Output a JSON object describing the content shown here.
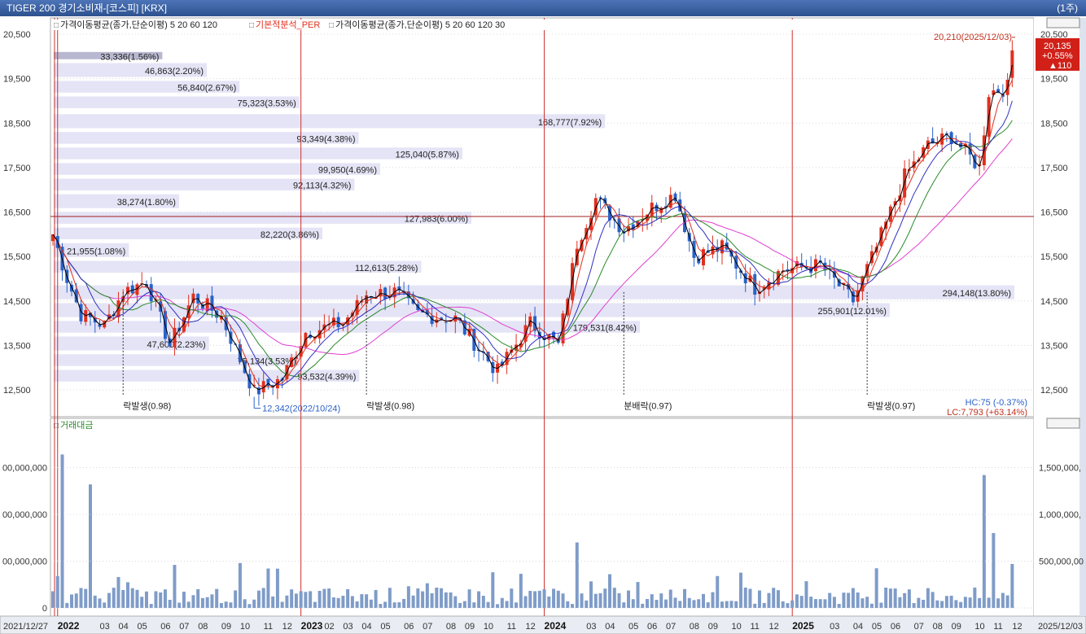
{
  "window": {
    "title": "TIGER 200 경기소비재-[코스피] [KRX]",
    "period": "(1주)"
  },
  "legends": {
    "price_ma": "가격이동평균(종가,단순이평) 5 20 60 120",
    "per": "기본적분석_PER",
    "per_ma": "가격이동평균(종가,단순이평) 5 20 60 120 30",
    "volume": "거래대금"
  },
  "colors": {
    "up": "#e0301e",
    "down": "#2a62c9",
    "ma5": "#000000",
    "ma20": "#e0301e",
    "ma60": "#2a8a2a",
    "ma120": "#e040d0",
    "ma30": "#3030c0",
    "volume_bar": "#7f9cc8",
    "profile": "#e4e4f6",
    "grid_v": "#cc3030",
    "hline": "#a02020"
  },
  "price_axis": {
    "ticks": [
      "20,500",
      "19,500",
      "18,500",
      "17,500",
      "16,500",
      "15,500",
      "14,500",
      "13,500",
      "12,500"
    ]
  },
  "right_axis": {
    "ticks": [
      "20,500",
      "19,500",
      "18,500",
      "17,500",
      "16,500",
      "15,500",
      "14,500",
      "13,500",
      "12,500"
    ]
  },
  "current_price": {
    "price": "20,135",
    "change_pct": "+0.55%",
    "change": "▲110"
  },
  "volume_axis_left": [
    "00,000,000",
    "00,000,000",
    "00,000,000",
    "0"
  ],
  "volume_axis_right": [
    "1,500,000,",
    "1,000,000,",
    "500,000,00"
  ],
  "x_axis": {
    "start_date": "2021/12/27",
    "end_date": "2025/12/03",
    "labels": [
      {
        "date": "2022-01-03",
        "text": "2022"
      },
      {
        "date": "2022-03-07",
        "text": "03"
      },
      {
        "date": "2022-04-04",
        "text": "04"
      },
      {
        "date": "2022-05-02",
        "text": "05"
      },
      {
        "date": "2022-06-06",
        "text": "06"
      },
      {
        "date": "2022-07-04",
        "text": "07"
      },
      {
        "date": "2022-08-01",
        "text": "08"
      },
      {
        "date": "2022-09-05",
        "text": "09"
      },
      {
        "date": "2022-10-03",
        "text": "10"
      },
      {
        "date": "2022-11-07",
        "text": "11"
      },
      {
        "date": "2022-12-05",
        "text": "12"
      },
      {
        "date": "2023-01-02",
        "text": "2023"
      },
      {
        "date": "2023-02-06",
        "text": "02"
      },
      {
        "date": "2023-03-06",
        "text": "03"
      },
      {
        "date": "2023-04-03",
        "text": "04"
      },
      {
        "date": "2023-05-01",
        "text": "05"
      },
      {
        "date": "2023-06-05",
        "text": "06"
      },
      {
        "date": "2023-07-03",
        "text": "07"
      },
      {
        "date": "2023-08-07",
        "text": "08"
      },
      {
        "date": "2023-09-04",
        "text": "09"
      },
      {
        "date": "2023-10-02",
        "text": "10"
      },
      {
        "date": "2023-11-06",
        "text": "11"
      },
      {
        "date": "2023-12-04",
        "text": "12"
      },
      {
        "date": "2024-01-01",
        "text": "2024"
      },
      {
        "date": "2024-03-04",
        "text": "03"
      },
      {
        "date": "2024-04-01",
        "text": "04"
      },
      {
        "date": "2024-05-06",
        "text": "05"
      },
      {
        "date": "2024-06-03",
        "text": "06"
      },
      {
        "date": "2024-07-01",
        "text": "07"
      },
      {
        "date": "2024-08-05",
        "text": "08"
      },
      {
        "date": "2024-09-02",
        "text": "09"
      },
      {
        "date": "2024-10-07",
        "text": "10"
      },
      {
        "date": "2024-11-04",
        "text": "11"
      },
      {
        "date": "2024-12-02",
        "text": "12"
      },
      {
        "date": "2025-01-06",
        "text": "2025"
      },
      {
        "date": "2025-03-03",
        "text": "03"
      },
      {
        "date": "2025-04-07",
        "text": "04"
      },
      {
        "date": "2025-05-05",
        "text": "05"
      },
      {
        "date": "2025-06-02",
        "text": "06"
      },
      {
        "date": "2025-07-07",
        "text": "07"
      },
      {
        "date": "2025-08-04",
        "text": "08"
      },
      {
        "date": "2025-09-01",
        "text": "09"
      },
      {
        "date": "2025-10-06",
        "text": "10"
      },
      {
        "date": "2025-11-03",
        "text": "11"
      },
      {
        "date": "2025-12-01",
        "text": "12"
      }
    ],
    "year_lines": [
      "2022-01-03",
      "2023-01-02",
      "2024-01-01",
      "2025-01-06"
    ]
  },
  "reference_line": {
    "price": 16400
  },
  "volume_profile": [
    {
      "label": "33,336(1.56%)",
      "price_from": 19900,
      "price_to": 20100,
      "pct": 1.56,
      "highlight": true
    },
    {
      "label": "46,863(2.20%)",
      "price_from": 19500,
      "price_to": 19850,
      "pct": 2.2
    },
    {
      "label": "56,840(2.67%)",
      "price_from": 19150,
      "price_to": 19450,
      "pct": 2.67
    },
    {
      "label": "75,323(3.53%)",
      "price_from": 18800,
      "price_to": 19100,
      "pct": 3.53
    },
    {
      "label": "168,777(7.92%)",
      "price_from": 18350,
      "price_to": 18700,
      "pct": 7.92
    },
    {
      "label": "93,349(4.38%)",
      "price_from": 18000,
      "price_to": 18300,
      "pct": 4.38
    },
    {
      "label": "125,040(5.87%)",
      "price_from": 17650,
      "price_to": 17950,
      "pct": 5.87
    },
    {
      "label": "99,950(4.69%)",
      "price_from": 17300,
      "price_to": 17600,
      "pct": 4.69
    },
    {
      "label": "92,113(4.32%)",
      "price_from": 16950,
      "price_to": 17250,
      "pct": 4.32
    },
    {
      "label": "38,274(1.80%)",
      "price_from": 16550,
      "price_to": 16900,
      "pct": 1.8
    },
    {
      "label": "127,983(6.00%)",
      "price_from": 16200,
      "price_to": 16500,
      "pct": 6.0
    },
    {
      "label": "82,220(3.86%)",
      "price_from": 15850,
      "price_to": 16150,
      "pct": 3.86
    },
    {
      "label": "21,955(1.08%)",
      "price_from": 15450,
      "price_to": 15800,
      "pct": 1.08
    },
    {
      "label": "112,613(5.28%)",
      "price_from": 15100,
      "price_to": 15400,
      "pct": 5.28
    },
    {
      "label": "294,148(13.80%)",
      "price_from": 14500,
      "price_to": 14850,
      "pct": 13.8
    },
    {
      "label": "255,901(12.01%)",
      "price_from": 14100,
      "price_to": 14450,
      "pct": 12.01
    },
    {
      "label": "179,531(8.42%)",
      "price_from": 13750,
      "price_to": 14050,
      "pct": 8.42
    },
    {
      "label": "47,600(2.23%)",
      "price_from": 13350,
      "price_to": 13700,
      "pct": 2.23
    },
    {
      "label": "75,134(3.53%)",
      "price_from": 13000,
      "price_to": 13300,
      "pct": 3.53
    },
    {
      "label": "93,532(4.39%)",
      "price_from": 12650,
      "price_to": 12950,
      "pct": 4.39
    }
  ],
  "annotations": [
    {
      "text": "락발생(0.98)",
      "date": "2022-04-11",
      "price": 12250
    },
    {
      "text": "락발생(0.98)",
      "date": "2023-04-10",
      "price": 12250
    },
    {
      "text": "분배락(0.97)",
      "date": "2024-04-29",
      "price": 12250
    },
    {
      "text": "락발생(0.97)",
      "date": "2025-04-28",
      "price": 12250
    },
    {
      "text": "12,342(2022/10/24)",
      "date": "2022-10-24",
      "price": 12342,
      "kind": "low"
    },
    {
      "text": "20,210(2025/12/03)",
      "date": "2025-12-03",
      "price": 20210,
      "kind": "high"
    }
  ],
  "hc_lc": {
    "hc": "HC:75 (-0.37%)",
    "lc": "LC:7,793 (+63.14%)"
  },
  "chart_data": {
    "type": "candlestick",
    "title": "TIGER 200 경기소비재-[코스피] [KRX]",
    "period": "weekly",
    "ylim": [
      12000,
      20600
    ],
    "key_points": [
      {
        "date": "2021-12-27",
        "close": 16000
      },
      {
        "date": "2022-01-17",
        "close": 15000
      },
      {
        "date": "2022-02-07",
        "close": 14200
      },
      {
        "date": "2022-03-14",
        "close": 13950
      },
      {
        "date": "2022-04-11",
        "close": 14700
      },
      {
        "date": "2022-05-16",
        "close": 14950
      },
      {
        "date": "2022-06-20",
        "close": 13500
      },
      {
        "date": "2022-07-25",
        "close": 14600
      },
      {
        "date": "2022-09-05",
        "close": 14150
      },
      {
        "date": "2022-10-24",
        "close": 12450
      },
      {
        "date": "2022-12-05",
        "close": 12750
      },
      {
        "date": "2023-01-09",
        "close": 13800
      },
      {
        "date": "2023-03-06",
        "close": 14000
      },
      {
        "date": "2023-04-10",
        "close": 14650
      },
      {
        "date": "2023-05-22",
        "close": 14700
      },
      {
        "date": "2023-06-26",
        "close": 14200
      },
      {
        "date": "2023-08-21",
        "close": 14100
      },
      {
        "date": "2023-10-23",
        "close": 12900
      },
      {
        "date": "2023-12-11",
        "close": 14000
      },
      {
        "date": "2024-01-22",
        "close": 13500
      },
      {
        "date": "2024-02-19",
        "close": 15800
      },
      {
        "date": "2024-03-18",
        "close": 16800
      },
      {
        "date": "2024-04-29",
        "close": 16100
      },
      {
        "date": "2024-06-10",
        "close": 16600
      },
      {
        "date": "2024-07-15",
        "close": 16900
      },
      {
        "date": "2024-08-12",
        "close": 15500
      },
      {
        "date": "2024-09-23",
        "close": 15700
      },
      {
        "date": "2024-11-11",
        "close": 14800
      },
      {
        "date": "2024-12-23",
        "close": 15200
      },
      {
        "date": "2025-02-17",
        "close": 15300
      },
      {
        "date": "2025-04-07",
        "close": 14500
      },
      {
        "date": "2025-05-12",
        "close": 15700
      },
      {
        "date": "2025-06-23",
        "close": 17300
      },
      {
        "date": "2025-07-28",
        "close": 18000
      },
      {
        "date": "2025-09-01",
        "close": 18200
      },
      {
        "date": "2025-10-13",
        "close": 17500
      },
      {
        "date": "2025-10-27",
        "close": 19200
      },
      {
        "date": "2025-11-24",
        "close": 19300
      },
      {
        "date": "2025-12-03",
        "close": 20135
      }
    ],
    "volume_peaks": [
      {
        "date": "2022-01-03",
        "value": 340
      },
      {
        "date": "2022-01-10",
        "value": 1640
      },
      {
        "date": "2022-02-21",
        "value": 1320
      },
      {
        "date": "2022-10-03",
        "value": 480
      },
      {
        "date": "2024-02-19",
        "value": 700
      },
      {
        "date": "2025-10-20",
        "value": 1420
      },
      {
        "date": "2025-11-03",
        "value": 800
      },
      {
        "date": "2025-12-01",
        "value": 470
      }
    ]
  }
}
